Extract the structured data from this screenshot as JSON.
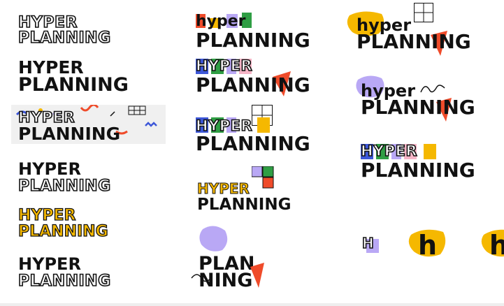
{
  "logos": {
    "l1": {
      "top": "HYPER",
      "bottom": "PLANNING"
    },
    "l2": {
      "top": "HYPER",
      "bottom": "PLANNING"
    },
    "l3": {
      "top": "HYPER",
      "bottom": "PLANNING"
    },
    "l4": {
      "top": "HYPER",
      "bottom": "PLANNING"
    },
    "l5": {
      "top": "HYPER",
      "bottom": "PLANNING"
    },
    "l6": {
      "top": "HYPER",
      "bottom": "PLANNING"
    },
    "m1": {
      "top": "hyper",
      "bottom": "PLANNING"
    },
    "m2": {
      "top": "HYPER",
      "bottom": "PLANNING"
    },
    "m3": {
      "top": "HYPER",
      "bottom": "PLANNING"
    },
    "m4": {
      "top": "HYPER",
      "bottom": "PLANNING"
    },
    "m5": {
      "top": "PLAN",
      "bottom": "NING"
    },
    "r1": {
      "top": "hyper",
      "bottom": "PLANNING"
    },
    "r2": {
      "top": "hyper",
      "bottom": "PLANNING"
    },
    "r3": {
      "top": "HYPER",
      "bottom": "PLANNING"
    },
    "icons": {
      "a": "H",
      "b": "h",
      "c": "h"
    }
  },
  "colors": {
    "yellow": "#f5b800",
    "purple": "#b9a8f5",
    "red": "#ef4b2a",
    "blue": "#3d57d8",
    "green": "#2f9e44",
    "dark": "#111111"
  }
}
